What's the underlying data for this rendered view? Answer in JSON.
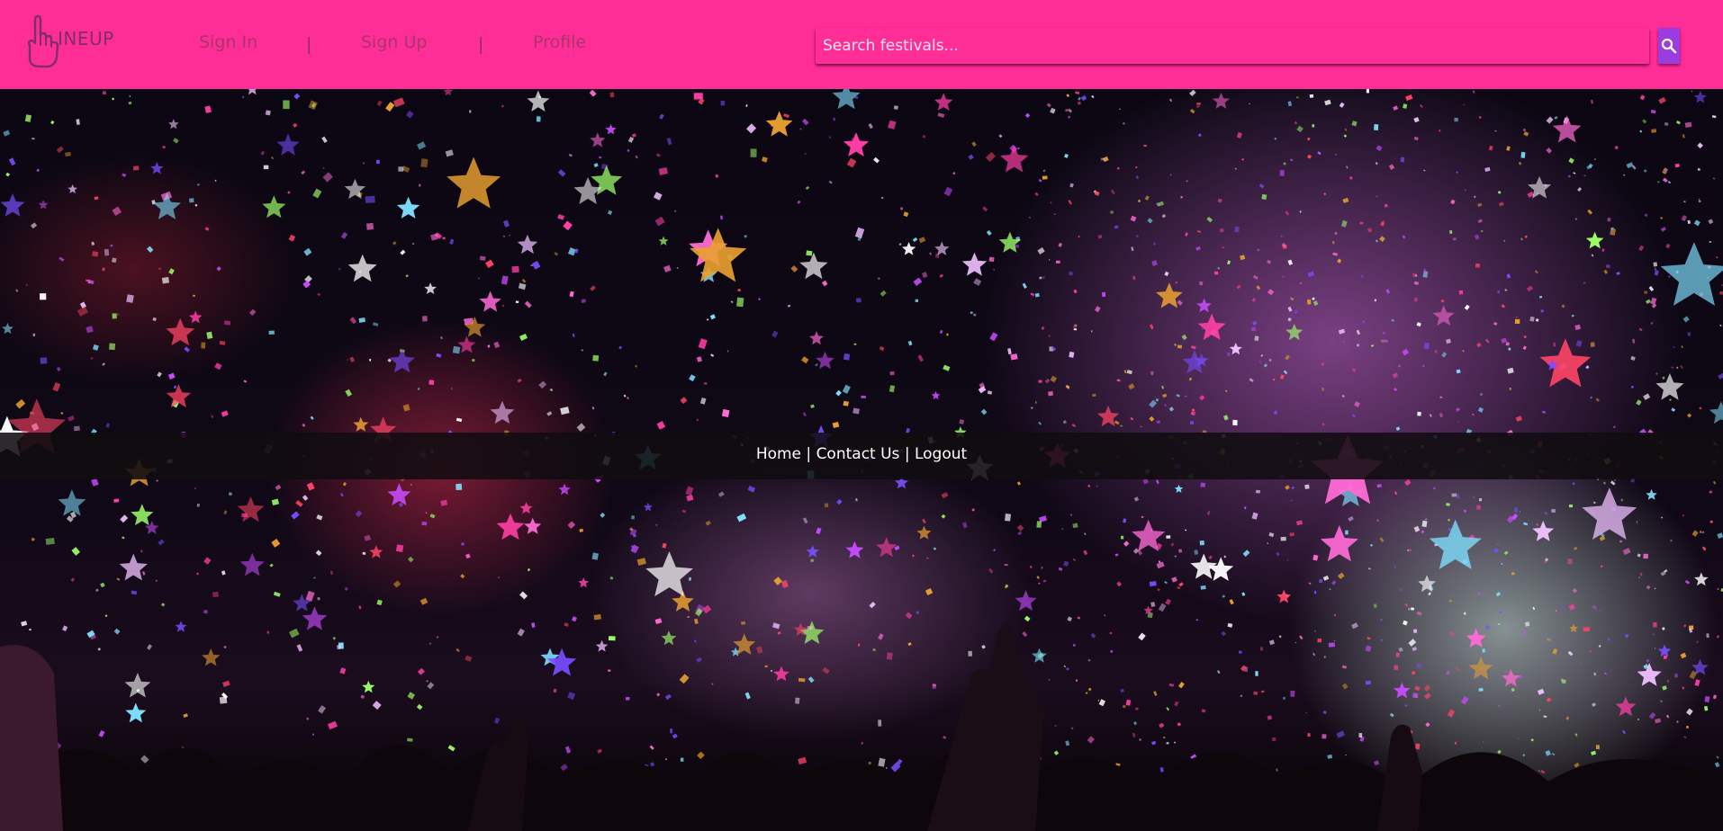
{
  "brand": {
    "logo_text": "INEUP"
  },
  "nav": {
    "sign_in": "Sign In",
    "separator_1": "|",
    "sign_up": "Sign Up",
    "separator_2": "|",
    "profile": "Profile"
  },
  "search": {
    "placeholder": "Search festivals...",
    "value": ""
  },
  "footer_nav": {
    "home": "Home",
    "separator_1": " | ",
    "contact": "Contact Us",
    "separator_2": " | ",
    "logout": "Logout"
  },
  "colors": {
    "header_background": "#ff2d96",
    "search_button": "#9b3ce0",
    "nav_text": "#a8356f",
    "footer_text": "#ffffff",
    "footer_bar": "#100d10"
  },
  "icons": {
    "logo": "hand-l-logo-icon",
    "search": "magnifier-icon"
  },
  "hero": {
    "image": "festival-confetti-crowd-photo"
  }
}
